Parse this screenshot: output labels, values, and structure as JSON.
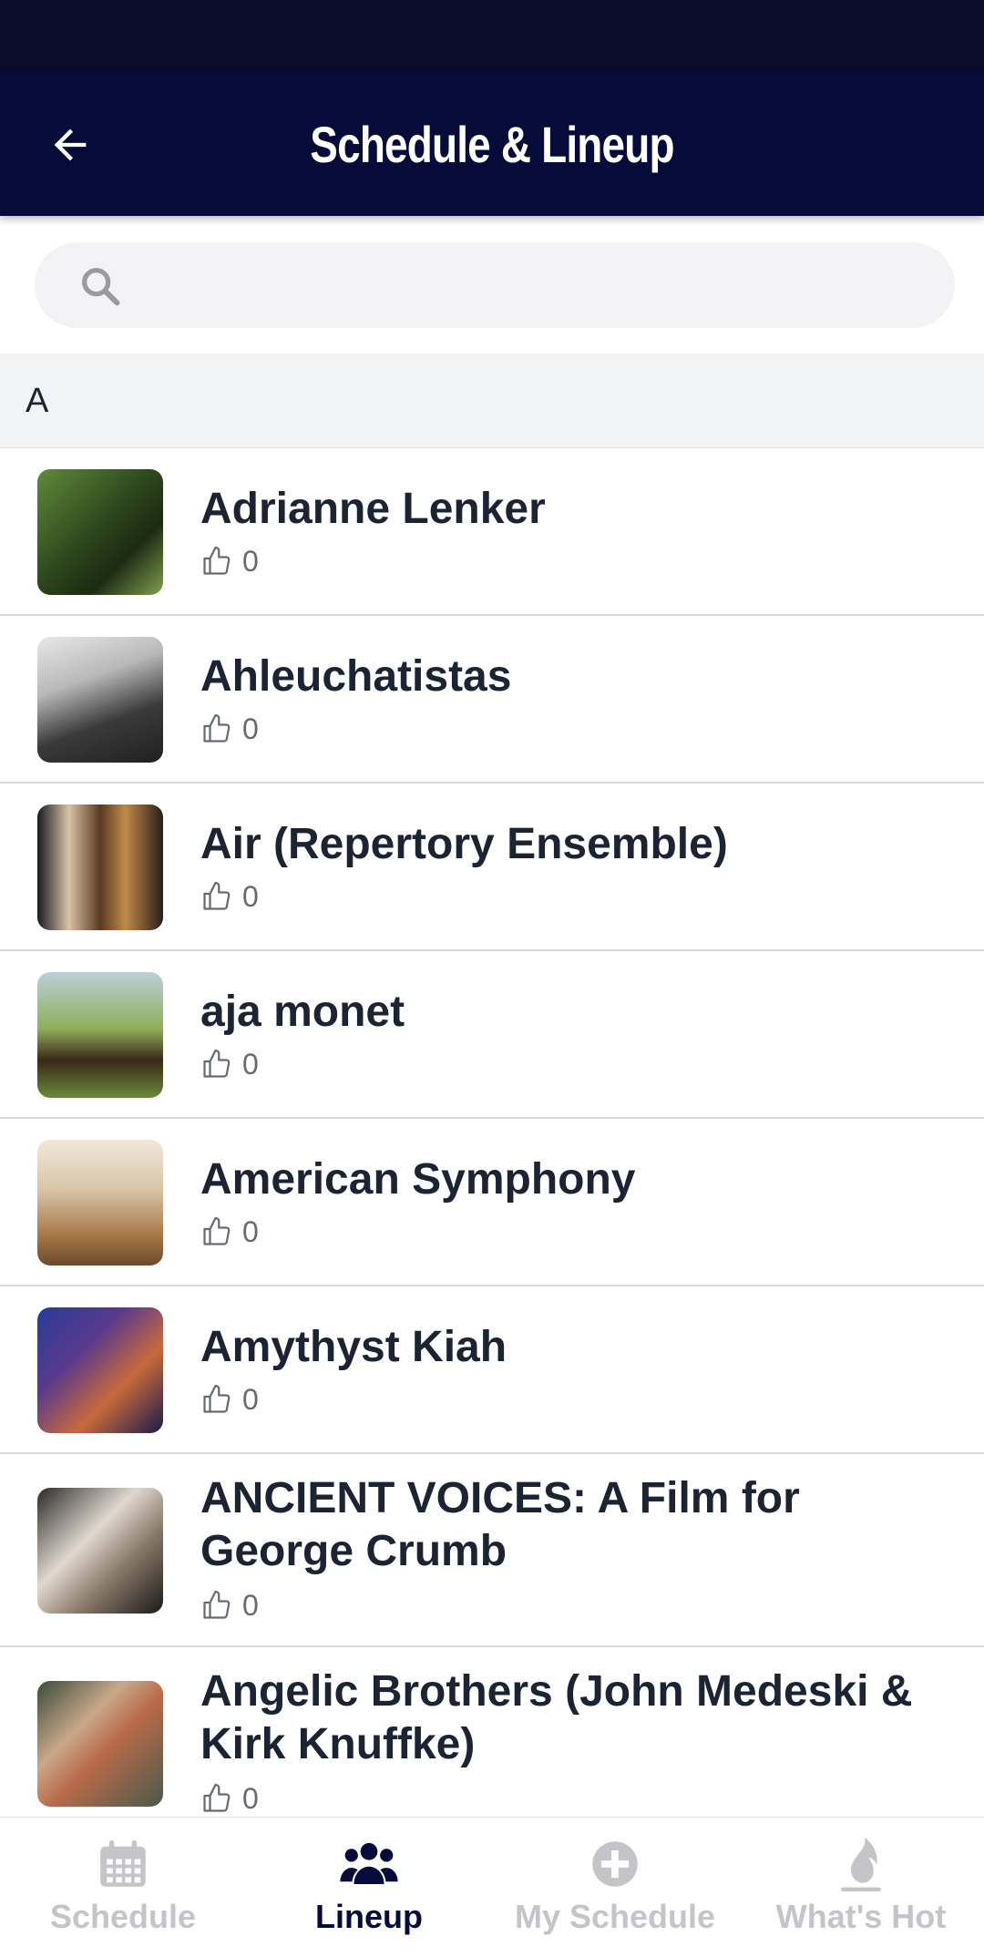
{
  "header": {
    "title": "Schedule & Lineup"
  },
  "search": {
    "placeholder": ""
  },
  "section": {
    "letter": "A"
  },
  "artists": [
    {
      "name": "Adrianne Lenker",
      "likes": "0"
    },
    {
      "name": "Ahleuchatistas",
      "likes": "0"
    },
    {
      "name": "Air (Repertory Ensemble)",
      "likes": "0"
    },
    {
      "name": "aja monet",
      "likes": "0"
    },
    {
      "name": "American Symphony",
      "likes": "0"
    },
    {
      "name": "Amythyst Kiah",
      "likes": "0"
    },
    {
      "name": "ANCIENT VOICES: A Film for George Crumb",
      "likes": "0"
    },
    {
      "name": "Angelic Brothers (John Medeski & Kirk Knuffke)",
      "likes": "0"
    }
  ],
  "tabs": [
    {
      "label": "Schedule",
      "icon": "calendar-icon",
      "active": false
    },
    {
      "label": "Lineup",
      "icon": "group-icon",
      "active": true
    },
    {
      "label": "My Schedule",
      "icon": "plus-circle-icon",
      "active": false
    },
    {
      "label": "What's Hot",
      "icon": "flame-icon",
      "active": false
    }
  ],
  "colors": {
    "app_bar": "#070b3a",
    "active_tab": "#070b3a",
    "inactive_tab": "#c4c4c9"
  }
}
